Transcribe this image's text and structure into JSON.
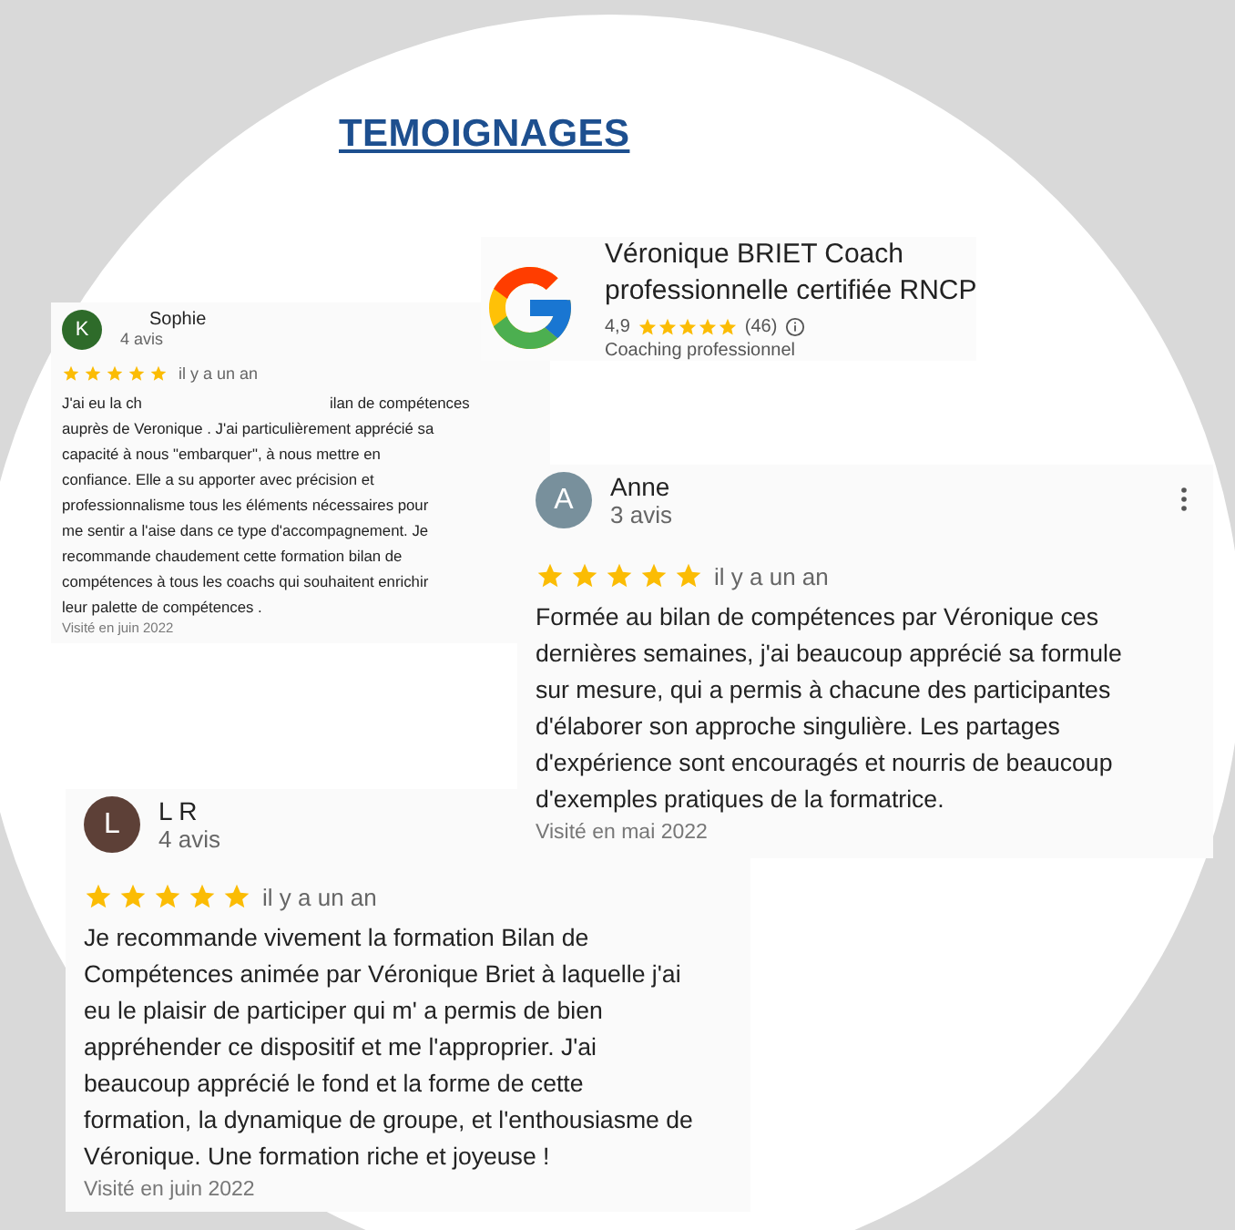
{
  "title": "TEMOIGNAGES",
  "business": {
    "name": "Véronique BRIET Coach\nprofessionnelle certifiée RNCP",
    "rating": "4,9",
    "stars": 5,
    "count": "(46)",
    "category": "Coaching professionnel"
  },
  "reviews": [
    {
      "kind": "small",
      "initial": "K",
      "color": "#2e6b2a",
      "name": "Sophie",
      "reviews_count": "4 avis",
      "stars": 5,
      "time": "il y a un an",
      "text_fragment": "J'ai eu la ch",
      "text_fragment_end": "ilan de compétences",
      "text": "auprès de Veronique . J'ai particulièrement apprécié sa\ncapacité à nous \"embarquer\", à nous mettre en\nconfiance. Elle a su apporter avec précision et\nprofessionnalisme tous les éléments nécessaires pour\nme sentir a l'aise dans ce type d'accompagnement. Je\nrecommande chaudement cette formation bilan de\ncompétences  à tous les coachs qui souhaitent enrichir\nleur palette de compétences .",
      "visited": "Visité en juin 2022"
    },
    {
      "kind": "large",
      "initial": "A",
      "color": "#78909c",
      "name": "Anne",
      "reviews_count": "3 avis",
      "stars": 5,
      "time": "il y a un an",
      "text": "Formée au bilan de compétences par Véronique ces\ndernières semaines, j'ai beaucoup apprécié sa formule\nsur mesure, qui a permis à chacune des participantes\nd'élaborer son approche singulière. Les partages\nd'expérience sont encouragés et nourris de beaucoup\nd'exemples pratiques de la formatrice.",
      "visited": "Visité en mai 2022",
      "menu": true
    },
    {
      "kind": "large",
      "initial": "L",
      "color": "#5d4037",
      "name": "L R",
      "reviews_count": "4 avis",
      "stars": 5,
      "time": "il y a un an",
      "text": "Je recommande vivement la formation Bilan de\nCompétences animée par Véronique Briet à laquelle j'ai\neu le plaisir de participer qui m' a permis de bien\nappréhender ce dispositif et me l'approprier. J'ai\nbeaucoup apprécié le fond et la forme de cette\nformation, la dynamique de groupe, et l'enthousiasme de\nVéronique. Une formation riche et joyeuse !",
      "visited": "Visité en juin 2022"
    }
  ]
}
